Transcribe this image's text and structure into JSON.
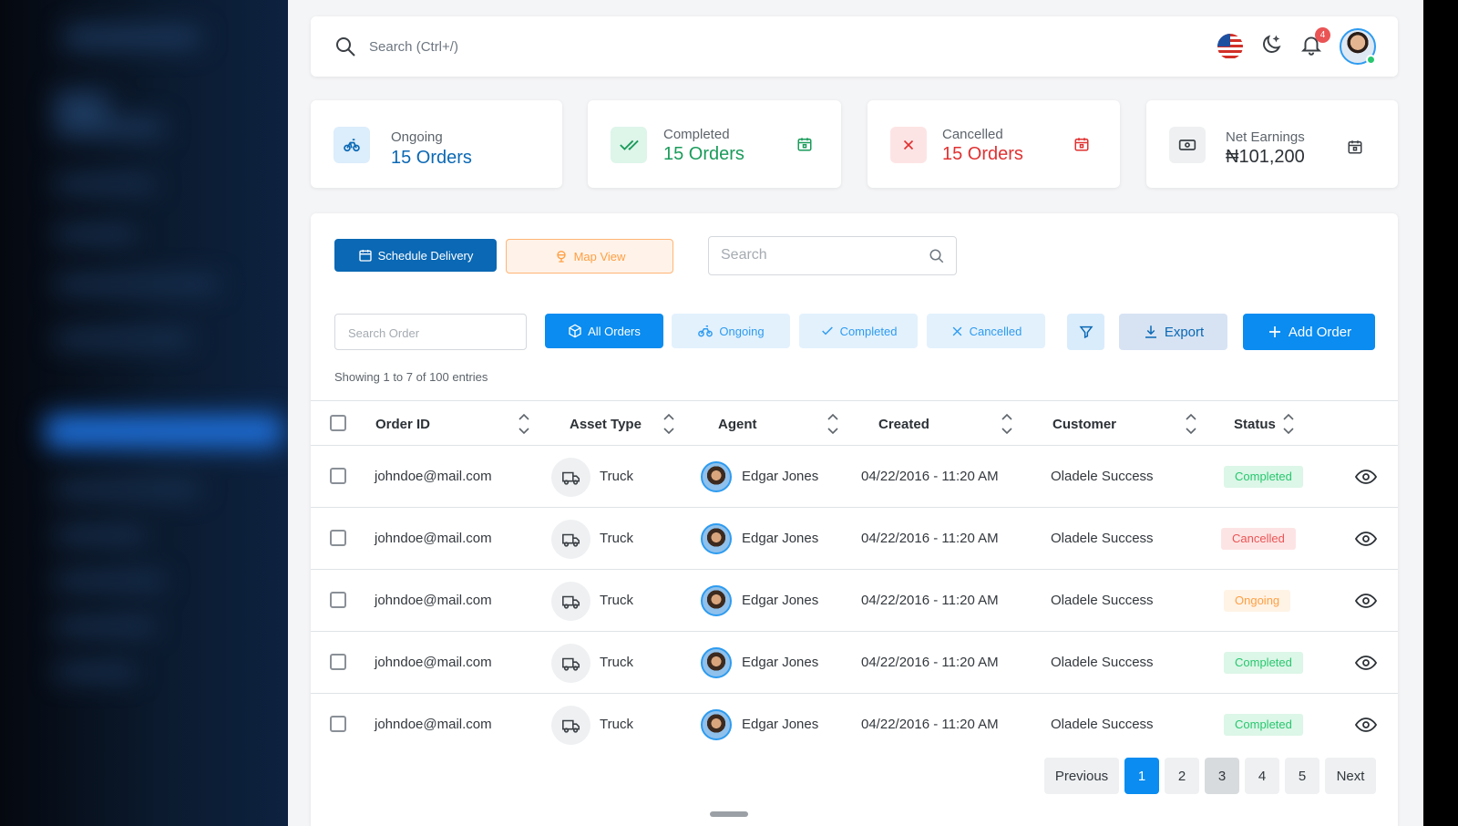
{
  "topbar": {
    "search_placeholder": "Search (Ctrl+/)",
    "notification_count": "4"
  },
  "stats": [
    {
      "label": "Ongoing",
      "value": "15 Orders",
      "color": "#0a68b4"
    },
    {
      "label": "Completed",
      "value": "15 Orders",
      "color": "#1a9b5b"
    },
    {
      "label": "Cancelled",
      "value": "15 Orders",
      "color": "#e03131"
    },
    {
      "label": "Net Earnings",
      "value": "₦101,200",
      "color": "#2c3136"
    }
  ],
  "toolbar": {
    "schedule_label": "Schedule Delivery",
    "map_label": "Map View",
    "search_placeholder": "Search"
  },
  "filters": {
    "order_search_placeholder": "Search Order",
    "all": "All Orders",
    "ongoing": "Ongoing",
    "completed": "Completed",
    "cancelled": "Cancelled",
    "export": "Export",
    "add": "Add Order"
  },
  "showing": "Showing 1 to 7 of 100 entries",
  "table": {
    "headers": [
      "Order ID",
      "Asset Type",
      "Agent",
      "Created",
      "Customer",
      "Status"
    ],
    "rows": [
      {
        "order_id": "johndoe@mail.com",
        "asset": "Truck",
        "agent": "Edgar Jones",
        "created": "04/22/2016 - 11:20 AM",
        "customer": "Oladele Success",
        "status": "Completed"
      },
      {
        "order_id": "johndoe@mail.com",
        "asset": "Truck",
        "agent": "Edgar Jones",
        "created": "04/22/2016 - 11:20 AM",
        "customer": "Oladele Success",
        "status": "Cancelled"
      },
      {
        "order_id": "johndoe@mail.com",
        "asset": "Truck",
        "agent": "Edgar Jones",
        "created": "04/22/2016 - 11:20 AM",
        "customer": "Oladele Success",
        "status": "Ongoing"
      },
      {
        "order_id": "johndoe@mail.com",
        "asset": "Truck",
        "agent": "Edgar Jones",
        "created": "04/22/2016 - 11:20 AM",
        "customer": "Oladele Success",
        "status": "Completed"
      },
      {
        "order_id": "johndoe@mail.com",
        "asset": "Truck",
        "agent": "Edgar Jones",
        "created": "04/22/2016 - 11:20 AM",
        "customer": "Oladele Success",
        "status": "Completed"
      }
    ]
  },
  "pagination": {
    "previous": "Previous",
    "pages": [
      "1",
      "2",
      "3",
      "4",
      "5"
    ],
    "next": "Next",
    "current": "1"
  }
}
